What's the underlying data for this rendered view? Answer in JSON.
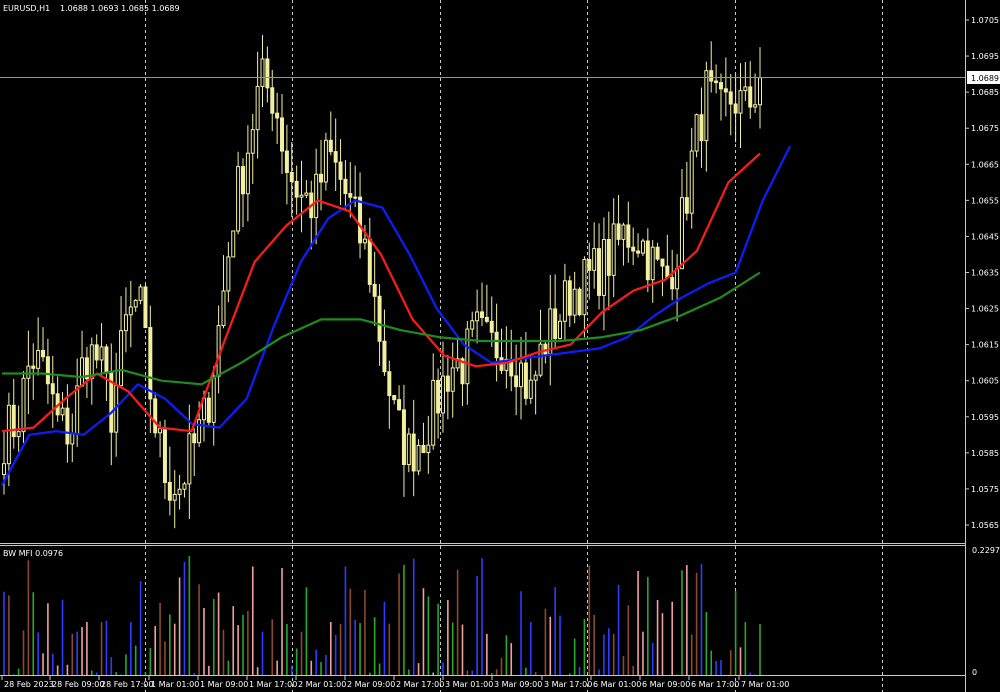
{
  "main_header": {
    "symbol": "EURUSD,H1",
    "ohlc": "1.0688 1.0693 1.0685 1.0689"
  },
  "indicator_header": {
    "label": "BW MFI 0.0976"
  },
  "price_marker": "1.0689",
  "colors": {
    "background": "#000000",
    "candle": "#f2f0a0",
    "grid": "#c8c8c8",
    "jaw": "#0a1eff",
    "teeth": "#ff1a1a",
    "lips": "#1e8c1e",
    "mfi_green": "#29a829",
    "mfi_blue": "#2e3cff",
    "mfi_pink": "#f0a0a0",
    "mfi_brown": "#8b4a2a"
  },
  "chart_data": [
    {
      "type": "candlestick",
      "title": "EURUSD,H1",
      "ylim": [
        1.056,
        1.071
      ],
      "y_ticks": [
        "1.0705",
        "1.0695",
        "1.0685",
        "1.0675",
        "1.0665",
        "1.0655",
        "1.0645",
        "1.0635",
        "1.0625",
        "1.0615",
        "1.0605",
        "1.0595",
        "1.0585",
        "1.0575",
        "1.0565"
      ],
      "x_ticks": [
        "28 Feb 2023",
        "28 Feb 09:00",
        "28 Feb 17:00",
        "1 Mar 01:00",
        "1 Mar 09:00",
        "1 Mar 17:00",
        "2 Mar 01:00",
        "2 Mar 09:00",
        "2 Mar 17:00",
        "3 Mar 01:00",
        "3 Mar 09:00",
        "3 Mar 17:00",
        "6 Mar 01:00",
        "6 Mar 09:00",
        "6 Mar 17:00",
        "7 Mar 01:00"
      ],
      "close_path": [
        1.059,
        1.0594,
        1.0612,
        1.0607,
        1.0593,
        1.0591,
        1.0613,
        1.0611,
        1.0596,
        1.062,
        1.0628,
        1.0597,
        1.0578,
        1.0576,
        1.0586,
        1.0596,
        1.0622,
        1.0652,
        1.0669,
        1.0688,
        1.0684,
        1.0664,
        1.0656,
        1.0654,
        1.0668,
        1.066,
        1.0649,
        1.0638,
        1.0614,
        1.0593,
        1.0585,
        1.059,
        1.0599,
        1.0609,
        1.061,
        1.0618,
        1.0614,
        1.0616,
        1.0611,
        1.0601,
        1.0616,
        1.0622,
        1.063,
        1.0632,
        1.0636,
        1.064,
        1.0646,
        1.0645,
        1.0638,
        1.0632,
        1.0644,
        1.0667,
        1.0685,
        1.0678,
        1.0684,
        1.068,
        1.0689
      ],
      "series": [
        {
          "name": "Jaw",
          "values": [
            1.0576,
            1.059,
            1.0591,
            1.059,
            1.0596,
            1.0604,
            1.06,
            1.0593,
            1.0592,
            1.06,
            1.062,
            1.0638,
            1.065,
            1.0655,
            1.0653,
            1.064,
            1.0625,
            1.0615,
            1.061,
            1.0611,
            1.0612,
            1.0613,
            1.0614,
            1.0617,
            1.0623,
            1.0628,
            1.0632,
            1.0635,
            1.0655,
            1.067
          ]
        },
        {
          "name": "Teeth",
          "values": [
            1.0591,
            1.0592,
            1.06,
            1.0607,
            1.0602,
            1.0592,
            1.0591,
            1.0615,
            1.0638,
            1.0648,
            1.0655,
            1.0652,
            1.064,
            1.0622,
            1.0612,
            1.0609,
            1.061,
            1.0613,
            1.0615,
            1.0624,
            1.063,
            1.0633,
            1.0641,
            1.066,
            1.0668
          ]
        },
        {
          "name": "Lips",
          "values": [
            1.0607,
            1.0607,
            1.0606,
            1.0608,
            1.0605,
            1.0604,
            1.061,
            1.0617,
            1.0622,
            1.0622,
            1.0619,
            1.0617,
            1.0616,
            1.0616,
            1.0616,
            1.0617,
            1.0619,
            1.0623,
            1.0628,
            1.0635
          ]
        }
      ]
    },
    {
      "type": "bar",
      "title": "BW MFI",
      "ylim": [
        0,
        0.2297
      ],
      "y_ticks": [
        "0.2297",
        "0"
      ],
      "current_value": 0.0976
    }
  ]
}
